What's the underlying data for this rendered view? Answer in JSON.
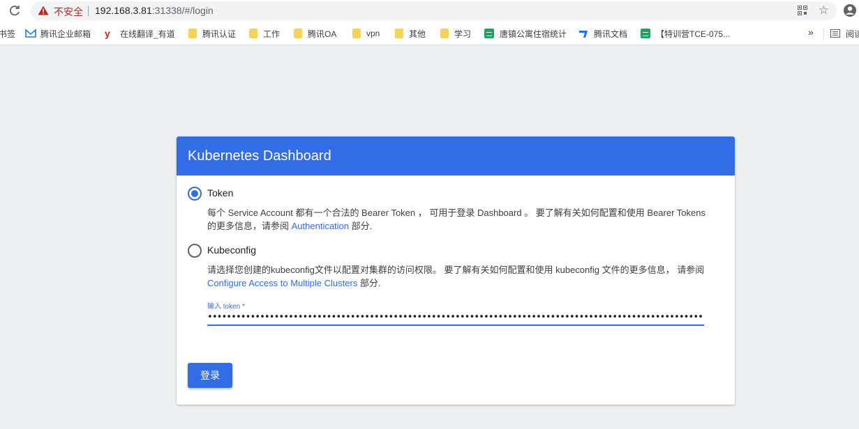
{
  "browser": {
    "security_label": "不安全",
    "url_host": "192.168.3.81",
    "url_rest": ":31338/#/login",
    "bookmarks": [
      {
        "label": "书签",
        "icon": "none"
      },
      {
        "label": "腾讯企业邮箱",
        "icon": "tencent-mail-icon"
      },
      {
        "label": "在线翻译_有道",
        "icon": "youdao-icon"
      },
      {
        "label": "腾讯认证",
        "icon": "folder-icon"
      },
      {
        "label": "工作",
        "icon": "folder-icon"
      },
      {
        "label": "腾讯OA",
        "icon": "folder-icon"
      },
      {
        "label": "vpn",
        "icon": "folder-icon"
      },
      {
        "label": "其他",
        "icon": "folder-icon"
      },
      {
        "label": "学习",
        "icon": "folder-icon"
      },
      {
        "label": "唐镇公寓住宿统计",
        "icon": "sheet-icon"
      },
      {
        "label": "腾讯文档",
        "icon": "tencent-docs-icon"
      },
      {
        "label": "【特训营TCE-075...",
        "icon": "sheet-icon"
      },
      {
        "label": "阅读",
        "icon": "reading-list-icon"
      }
    ],
    "more_label": "»"
  },
  "card": {
    "title": "Kubernetes Dashboard",
    "token": {
      "label": "Token",
      "selected": true,
      "desc_before": "每个 Service Account 都有一个合法的 Bearer Token ， 可用于登录 Dashboard 。 要了解有关如何配置和使用 Bearer Tokens 的更多信息，请参阅 ",
      "link": "Authentication",
      "desc_after": " 部分."
    },
    "kubeconfig": {
      "label": "Kubeconfig",
      "selected": false,
      "desc_before": "请选择您创建的kubeconfig文件以配置对集群的访问权限。 要了解有关如何配置和使用 kubeconfig 文件的更多信息， 请参阅",
      "link": "Configure Access to Multiple Clusters",
      "desc_after": " 部分."
    },
    "token_field_label": "输入 token *",
    "token_value": "••••••••••••••••••••••••••••••••••••••••••••••••••••••••••••••••••••••••••••••••••••••••••••••••••••••••••••••••••••",
    "login_label": "登录"
  },
  "colors": {
    "accent": "#326de6",
    "page_bg": "#eeeff0",
    "insecure": "#c5221f"
  }
}
